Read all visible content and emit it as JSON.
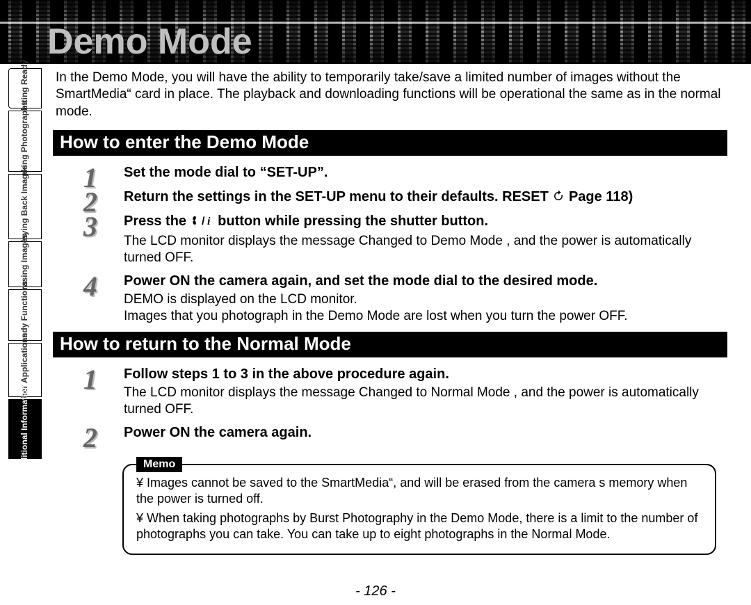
{
  "banner": {
    "title": "Demo Mode"
  },
  "tabs": [
    {
      "label": "Getting\nReady",
      "hclass": "tab-h-42",
      "active": false
    },
    {
      "label": "Taking\nPhotographs",
      "hclass": "tab-h-70",
      "active": false
    },
    {
      "label": "Playing\nBack Images",
      "hclass": "tab-h-78",
      "active": false
    },
    {
      "label": "Erasing\nImages",
      "hclass": "tab-h-54",
      "active": false
    },
    {
      "label": "Handy\nFunctions",
      "hclass": "tab-h-62",
      "active": false
    },
    {
      "label": "Other\nApplications",
      "hclass": "tab-h-66",
      "active": false
    },
    {
      "label": "Additional\nInformation",
      "hclass": "tab-h-74",
      "active": true
    }
  ],
  "intro": "In the Demo Mode, you will have the ability to temporarily take/save a limited number of images without the SmartMedia“ card in place. The playback and downloading functions will be operational the same as in the normal mode.",
  "section1": {
    "heading": "How to enter the Demo Mode",
    "steps": [
      {
        "num": "1",
        "head": "Set the mode dial to “SET-UP”.",
        "body": ""
      },
      {
        "num": "2",
        "head_pre": "Return the settings in the SET-UP menu to their defaults. RESET ",
        "head_post": " Page 118)",
        "body": "",
        "has_reset_icon": true
      },
      {
        "num": "3",
        "head_pre": "Press the ",
        "head_post": " button while pressing the shutter button.",
        "body": "The LCD monitor displays the message  Changed to Demo Mode , and the power is automatically turned OFF.",
        "has_macro_icon": true
      },
      {
        "num": "4",
        "head": "Power ON the camera again, and set the mode dial to the desired mode.",
        "body": " DEMO  is displayed on the LCD monitor.\nImages that you photograph in the Demo Mode are lost when you turn the power OFF."
      }
    ]
  },
  "section2": {
    "heading": "How to return to the Normal Mode",
    "steps": [
      {
        "num": "1",
        "head": "Follow steps 1 to 3 in the above procedure again.",
        "body": "The LCD monitor displays the message  Changed to Normal Mode , and the power is automatically turned OFF."
      },
      {
        "num": "2",
        "head": "Power ON the camera again.",
        "body": ""
      }
    ]
  },
  "memo": {
    "label": "Memo",
    "items": [
      "¥  Images cannot be saved to the SmartMedia“, and will be erased from the camera s memory when the power is turned off.",
      "¥  When taking photographs by Burst Photography in the Demo Mode, there is a limit to the number of photographs you can take. You can take up to eight photographs in the Normal Mode."
    ]
  },
  "page": "- 126 -"
}
